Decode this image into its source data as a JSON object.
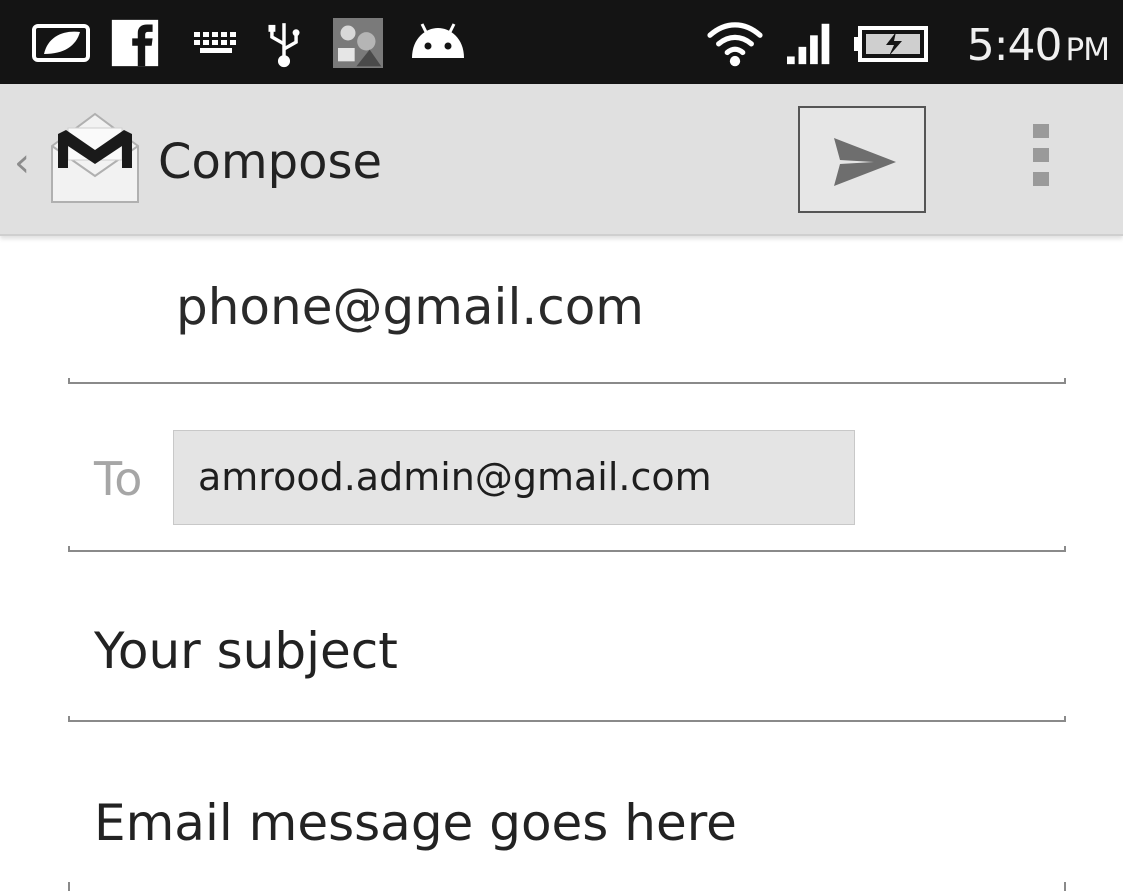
{
  "status_bar": {
    "time": "5:40",
    "ampm": "PM",
    "icons": [
      "leaf-icon",
      "facebook-icon",
      "keyboard-icon",
      "usb-icon",
      "photo-thumbnail-icon",
      "android-icon",
      "wifi-icon",
      "signal-icon",
      "battery-charging-icon"
    ]
  },
  "action_bar": {
    "title": "Compose",
    "app_icon": "gmail-icon",
    "send_icon": "send-icon",
    "overflow_icon": "overflow-menu-icon"
  },
  "compose": {
    "from": "phone@gmail.com",
    "to_label": "To",
    "to_recipient": "amrood.admin@gmail.com",
    "subject": "Your subject",
    "body": "Email message goes here"
  },
  "colors": {
    "status_bar_bg": "#141414",
    "action_bar_bg": "#e0e0e0",
    "chip_bg": "#e4e4e4"
  }
}
